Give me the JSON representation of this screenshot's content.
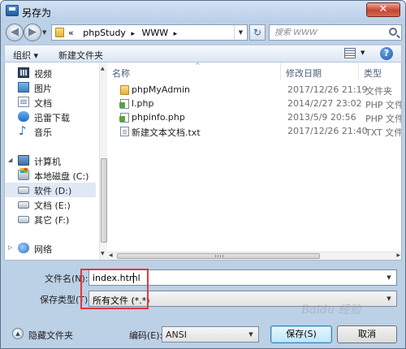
{
  "window": {
    "title": "另存为",
    "close_glyph": "✕"
  },
  "address": {
    "prefix": "«",
    "crumbs": [
      "phpStudy",
      "WWW"
    ],
    "separator": "▸",
    "search_placeholder": "搜索 WWW"
  },
  "toolbar": {
    "organize": "组织 ▾",
    "new_folder": "新建文件夹",
    "help": "?"
  },
  "nav": {
    "items": [
      {
        "label": "视频",
        "icon": "video-icon"
      },
      {
        "label": "图片",
        "icon": "image-icon"
      },
      {
        "label": "文档",
        "icon": "document-icon"
      },
      {
        "label": "迅雷下载",
        "icon": "thunder-icon"
      },
      {
        "label": "音乐",
        "icon": "music-icon"
      },
      {
        "label": "计算机",
        "icon": "computer-icon"
      },
      {
        "label": "本地磁盘 (C:)",
        "icon": "drive-c-icon"
      },
      {
        "label": "软件 (D:)",
        "icon": "drive-icon"
      },
      {
        "label": "文档 (E:)",
        "icon": "drive-icon"
      },
      {
        "label": "其它 (F:)",
        "icon": "drive-icon"
      },
      {
        "label": "网络",
        "icon": "network-icon"
      }
    ],
    "selected": "软件 (D:)"
  },
  "files": {
    "columns": {
      "name": "名称",
      "date": "修改日期",
      "type": "类型"
    },
    "rows": [
      {
        "name": "phpMyAdmin",
        "date": "2017/12/26 21:19",
        "type": "文件夹",
        "icon": "folder-icon"
      },
      {
        "name": "l.php",
        "date": "2014/2/27 23:02",
        "type": "PHP 文件",
        "icon": "php-file-icon"
      },
      {
        "name": "phpinfo.php",
        "date": "2013/5/9 20:56",
        "type": "PHP 文件",
        "icon": "php-file-icon"
      },
      {
        "name": "新建文本文档.txt",
        "date": "2017/12/26 21:40",
        "type": "TXT 文件",
        "icon": "text-file-icon"
      }
    ]
  },
  "form": {
    "filename_label": "文件名(N):",
    "filename_value": "index.html",
    "filetype_label": "保存类型(T):",
    "filetype_value": "所有文件 (*.*)",
    "hide_folders": "隐藏文件夹",
    "encoding_label": "编码(E):",
    "encoding_value": "ANSI",
    "save": "保存(S)",
    "cancel": "取消"
  },
  "watermark": "Baidu 经验",
  "colors": {
    "highlight": "#e0393c",
    "window_frame": "#bcd0e6"
  }
}
